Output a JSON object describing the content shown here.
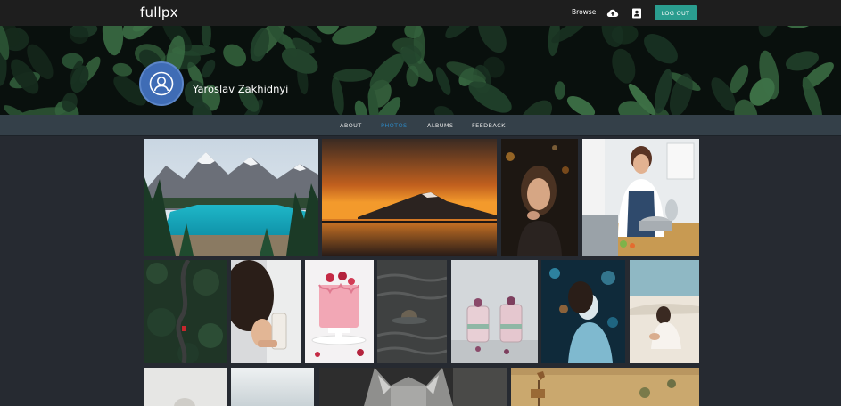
{
  "header": {
    "logo": "fullpx",
    "browse_label": "Browse",
    "logout_label": "LOG OUT",
    "upload_icon": "cloud-upload-icon",
    "profile_icon": "profile-card-icon",
    "accent": "#2a9d8f"
  },
  "profile": {
    "name": "Yaroslav Zakhidnyi",
    "avatar_icon": "user-avatar-icon",
    "avatar_color": "#3f6cb5"
  },
  "tabs": [
    {
      "label": "ABOUT",
      "active": false
    },
    {
      "label": "PHOTOS",
      "active": true
    },
    {
      "label": "ALBUMS",
      "active": false
    },
    {
      "label": "FEEDBACK",
      "active": false
    }
  ],
  "active_tab_color": "#2d86c0",
  "gallery": [
    {
      "subject": "mountain-lake"
    },
    {
      "subject": "volcano-sunset"
    },
    {
      "subject": "woman-portrait-night"
    },
    {
      "subject": "woman-cooking"
    },
    {
      "subject": "forest-road-aerial"
    },
    {
      "subject": "hand-with-glass"
    },
    {
      "subject": "pink-cake"
    },
    {
      "subject": "seal-in-water"
    },
    {
      "subject": "jars-with-berries"
    },
    {
      "subject": "woman-blue-lights"
    },
    {
      "subject": "woman-on-sand"
    },
    {
      "subject": "person-light-backdrop"
    },
    {
      "subject": "sky-photo"
    },
    {
      "subject": "wolf-closeup"
    },
    {
      "subject": "giraffe-savanna"
    }
  ]
}
